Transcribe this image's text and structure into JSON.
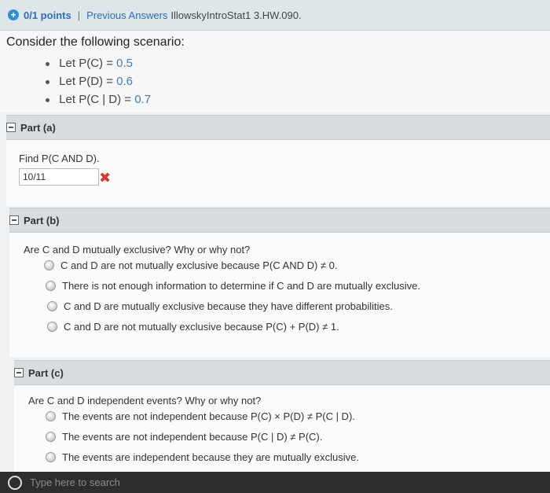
{
  "header": {
    "points": "0/1 points",
    "separator": "|",
    "previous_answers": "Previous Answers",
    "problem_code": "IllowskyIntroStat1 3.HW.090."
  },
  "scenario": {
    "title": "Consider the following scenario:",
    "items": [
      {
        "label": "Let P(C) = ",
        "value": "0.5"
      },
      {
        "label": "Let P(D) = ",
        "value": "0.6"
      },
      {
        "label": "Let P(C | D) = ",
        "value": "0.7"
      }
    ]
  },
  "part_a": {
    "label": "Part (a)",
    "question": "Find P(C AND D).",
    "answer": "10/11",
    "result_icon": "✖"
  },
  "part_b": {
    "label": "Part (b)",
    "question": "Are C and D mutually exclusive? Why or why not?",
    "options": [
      "C and D are not mutually exclusive because P(C AND D) ≠ 0.",
      "There is not enough information to determine if C and D are mutually exclusive.",
      "C and D are mutually exclusive because they have different probabilities.",
      "C and D are not mutually exclusive because P(C) + P(D) ≠ 1."
    ]
  },
  "part_c": {
    "label": "Part (c)",
    "question": "Are C and D independent events? Why or why not?",
    "options": [
      "The events are not independent because P(C) × P(D) ≠ P(C | D).",
      "The events are not independent because P(C | D) ≠ P(C).",
      "The events are independent because they are mutually exclusive."
    ]
  },
  "taskbar": {
    "search_placeholder": "Type here to search"
  },
  "colors": {
    "accent_blue": "#2a6ebb",
    "value_blue": "#3a7fc2",
    "error_red": "#d7392f"
  }
}
